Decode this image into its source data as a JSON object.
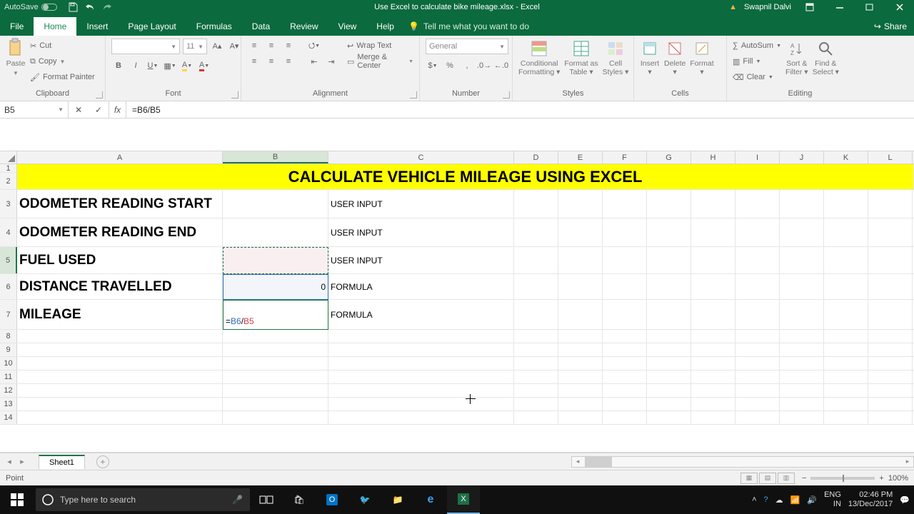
{
  "titlebar": {
    "autosave": "AutoSave",
    "filename": "Use Excel to calculate bike mileage.xlsx - Excel",
    "user": "Swapnil Dalvi"
  },
  "tabs": {
    "file": "File",
    "home": "Home",
    "insert": "Insert",
    "pagelayout": "Page Layout",
    "formulas": "Formulas",
    "data": "Data",
    "review": "Review",
    "view": "View",
    "help": "Help",
    "tellme": "Tell me what you want to do",
    "share": "Share"
  },
  "ribbon": {
    "clipboard": {
      "label": "Clipboard",
      "paste": "Paste",
      "cut": "Cut",
      "copy": "Copy",
      "fp": "Format Painter"
    },
    "font": {
      "label": "Font",
      "size": "11"
    },
    "alignment": {
      "label": "Alignment",
      "wrap": "Wrap Text",
      "merge": "Merge & Center"
    },
    "number": {
      "label": "Number",
      "general": "General"
    },
    "styles": {
      "label": "Styles",
      "cf": "Conditional",
      "cf2": "Formatting",
      "fat": "Format as",
      "fat2": "Table",
      "cs": "Cell",
      "cs2": "Styles"
    },
    "cells": {
      "label": "Cells",
      "insert": "Insert",
      "delete": "Delete",
      "format": "Format"
    },
    "editing": {
      "label": "Editing",
      "autosum": "AutoSum",
      "fill": "Fill",
      "clear": "Clear",
      "sort": "Sort &",
      "sort2": "Filter",
      "find": "Find &",
      "find2": "Select"
    }
  },
  "fbar": {
    "name": "B5",
    "formula": "=B6/B5"
  },
  "columns": [
    "A",
    "B",
    "C",
    "D",
    "E",
    "F",
    "G",
    "H",
    "I",
    "J",
    "K",
    "L"
  ],
  "sheet": {
    "title": "CALCULATE VEHICLE MILEAGE USING EXCEL",
    "rows": {
      "3": {
        "A": "ODOMETER READING START",
        "C": "USER INPUT"
      },
      "4": {
        "A": "ODOMETER READING END",
        "C": "USER INPUT"
      },
      "5": {
        "A": "FUEL USED",
        "C": "USER INPUT"
      },
      "6": {
        "A": "DISTANCE TRAVELLED",
        "B": "0",
        "C": "FORMULA"
      },
      "7": {
        "A": "MILEAGE",
        "B_prefix": "=",
        "B_ref1": "B6",
        "B_slash": "/",
        "B_ref2": "B5",
        "C": "FORMULA"
      }
    }
  },
  "sheettab": "Sheet1",
  "status": {
    "mode": "Point",
    "zoom": "100%"
  },
  "taskbar": {
    "search_placeholder": "Type here to search",
    "lang": "ENG",
    "kbd": "IN",
    "time": "02:46 PM",
    "date": "13/Dec/2017"
  }
}
